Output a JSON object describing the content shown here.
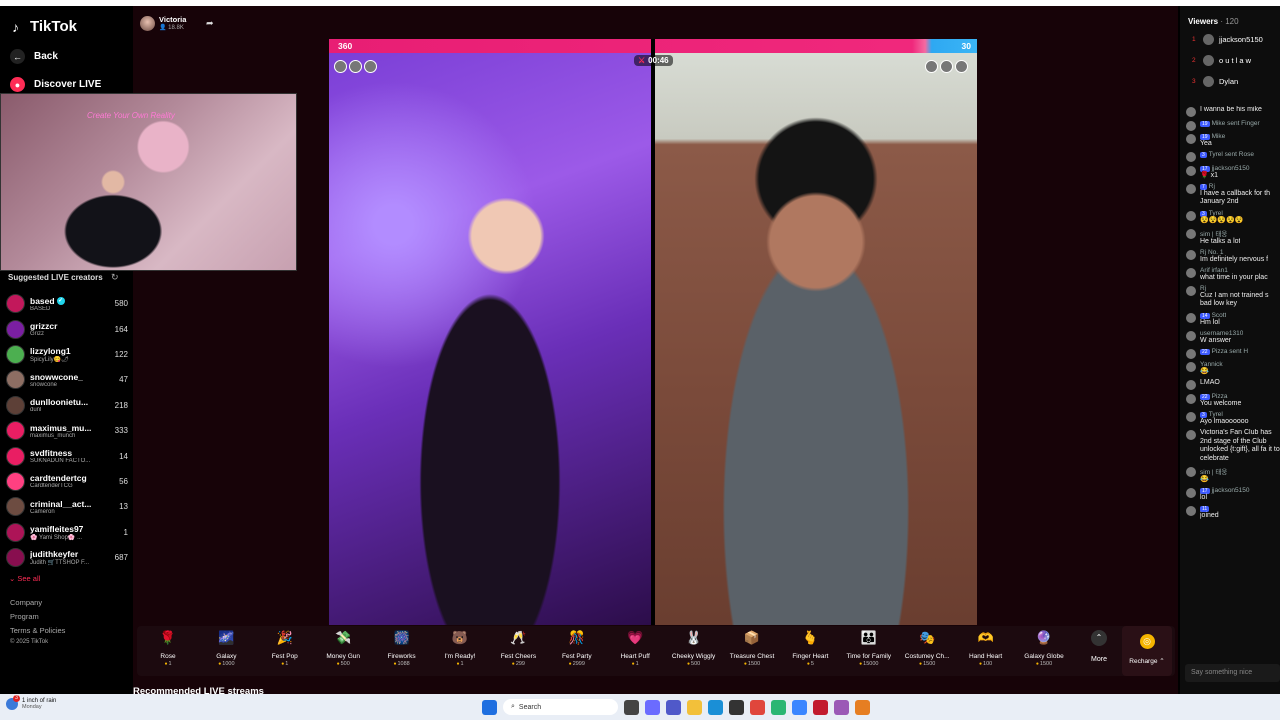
{
  "app": {
    "name": "TikTok"
  },
  "sidebar": {
    "back_label": "Back",
    "discover_label": "Discover LIVE",
    "suggested_title": "Suggested LIVE creators",
    "creators": [
      {
        "name": "based",
        "sub": "BASED",
        "count": "580",
        "color": "#c2185b",
        "verified": true
      },
      {
        "name": "grizzcr",
        "sub": "Grizz",
        "count": "164",
        "color": "#7b1fa2"
      },
      {
        "name": "lizzylong1",
        "sub": "SpicyLily😋🌶",
        "count": "122",
        "color": "#4caf50"
      },
      {
        "name": "snowwcone_",
        "sub": "snowcone",
        "count": "47",
        "color": "#8d6e63"
      },
      {
        "name": "dunlloonietu...",
        "sub": "dunl",
        "count": "218",
        "color": "#5d4037"
      },
      {
        "name": "maximus_mu...",
        "sub": "maximus_munch",
        "count": "333",
        "color": "#e91e63"
      },
      {
        "name": "svdfitness",
        "sub": "SUKNADUN FACTO...",
        "count": "14",
        "color": "#e91e63"
      },
      {
        "name": "cardtendertcg",
        "sub": "CardtenderTCG",
        "count": "56",
        "color": "#ff4081"
      },
      {
        "name": "criminal__act...",
        "sub": "Cameron",
        "count": "13",
        "color": "#6d4c41"
      },
      {
        "name": "yamifleites97",
        "sub": "🌸 Yami Shop🌸 ...",
        "count": "1",
        "color": "#ad1457"
      },
      {
        "name": "judithkeyfer",
        "sub": "Judith 🛒TTSHOP F...",
        "count": "687",
        "color": "#880e4f"
      }
    ],
    "see_all": "See all",
    "footer": [
      "Company",
      "Program",
      "Terms & Policies",
      "© 2025 TikTok"
    ]
  },
  "host": {
    "name": "Victoria",
    "followers": "18.8K"
  },
  "battle": {
    "score_left": "360",
    "score_right": "30",
    "timer": "00:46"
  },
  "pip": {
    "neon_text": "Create Your Own Reality"
  },
  "gifts": [
    {
      "name": "Rose",
      "price": "1",
      "icon": "🌹"
    },
    {
      "name": "Galaxy",
      "price": "1000",
      "icon": "🌌"
    },
    {
      "name": "Fest Pop",
      "price": "1",
      "icon": "🎉"
    },
    {
      "name": "Money Gun",
      "price": "500",
      "icon": "💸"
    },
    {
      "name": "Fireworks",
      "price": "1088",
      "icon": "🎆"
    },
    {
      "name": "I'm Ready!",
      "price": "1",
      "icon": "🐻"
    },
    {
      "name": "Fest Cheers",
      "price": "299",
      "icon": "🥂"
    },
    {
      "name": "Fest Party",
      "price": "2999",
      "icon": "🎊"
    },
    {
      "name": "Heart Puff",
      "price": "1",
      "icon": "💗"
    },
    {
      "name": "Cheeky Wiggly",
      "price": "500",
      "icon": "🐰"
    },
    {
      "name": "Treasure Chest",
      "price": "1500",
      "icon": "📦"
    },
    {
      "name": "Finger Heart",
      "price": "5",
      "icon": "🫰"
    },
    {
      "name": "Time for Family",
      "price": "15000",
      "icon": "👪"
    },
    {
      "name": "Costumey Ch...",
      "price": "1500",
      "icon": "🎭"
    },
    {
      "name": "Hand Heart",
      "price": "100",
      "icon": "🫶"
    },
    {
      "name": "Galaxy Globe",
      "price": "1500",
      "icon": "🔮"
    }
  ],
  "more_label": "More",
  "recharge_label": "Recharge",
  "recommended_title": "Recommended LIVE streams",
  "viewers": {
    "title": "Viewers",
    "count": "· 120",
    "top": [
      {
        "rank": "1",
        "name": "jjackson5150"
      },
      {
        "rank": "2",
        "name": "o u t l a w"
      },
      {
        "rank": "3",
        "name": "Dylan"
      }
    ]
  },
  "chat": [
    {
      "user": "",
      "badge": "",
      "text": "I wanna be his mike"
    },
    {
      "user": "Mike sent Finger",
      "badge": "19",
      "text": ""
    },
    {
      "user": "Mike",
      "badge": "19",
      "text": "Yea"
    },
    {
      "user": "Tyrel sent Rose",
      "badge": "3",
      "text": ""
    },
    {
      "user": "jjackson5150",
      "badge": "17",
      "text": "🌹 x1"
    },
    {
      "user": "Rj",
      "badge": "7",
      "text": "I have a callback for th January 2nd"
    },
    {
      "user": "Tyrel",
      "badge": "3",
      "text": "😵😵😵😵😵"
    },
    {
      "user": "sim | 태웅",
      "badge": "",
      "text": "He talks a lot"
    },
    {
      "user": "Rj  No. 1",
      "badge": "",
      "text": "Im definitely nervous f"
    },
    {
      "user": "Arif irfan1",
      "badge": "",
      "text": "what time in your plac"
    },
    {
      "user": "Rj",
      "badge": "",
      "text": "Cuz I am not trained s bad low key"
    },
    {
      "user": "Scott",
      "badge": "14",
      "text": "Hm lol"
    },
    {
      "user": "username1310",
      "badge": "",
      "text": "W answer"
    },
    {
      "user": "Pizza sent H",
      "badge": "22",
      "text": ""
    },
    {
      "user": "Yannick",
      "badge": "",
      "text": "😂"
    },
    {
      "user": "",
      "badge": "",
      "text": "LMAO"
    },
    {
      "user": "Pizza",
      "badge": "22",
      "text": "You welcome"
    },
    {
      "user": "Tyrel",
      "badge": "3",
      "text": "Ayo lmaoooooo"
    },
    {
      "user": "",
      "badge": "",
      "text": "Victoria's Fan Club has 2nd stage of the Club unlocked {t:gift}, all fa it to celebrate"
    },
    {
      "user": "sim | 태웅",
      "badge": "",
      "text": "😂"
    },
    {
      "user": "jjackson5150",
      "badge": "17",
      "text": "lol"
    },
    {
      "user": "",
      "badge": "11",
      "text": "joined"
    }
  ],
  "chat_placeholder": "Say something nice",
  "taskbar": {
    "weather_line1": "1 inch of rain",
    "weather_line2": "Monday",
    "weather_badge": "3",
    "search": "Search"
  }
}
